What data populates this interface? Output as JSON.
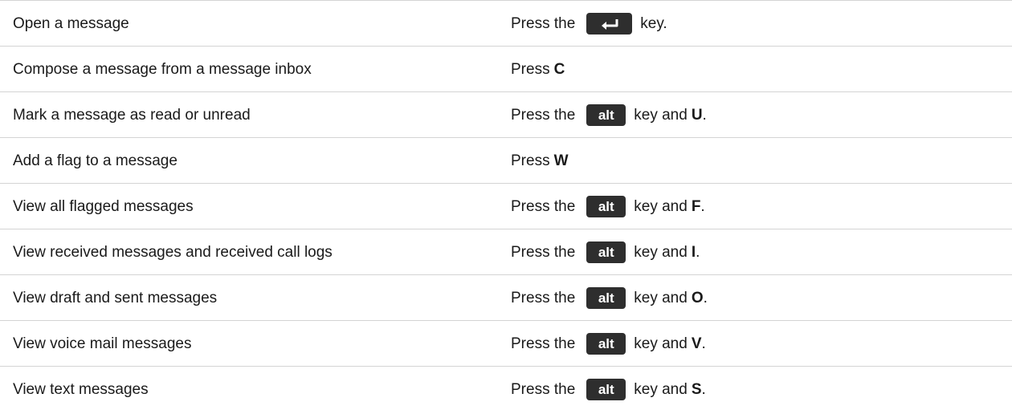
{
  "rows": [
    {
      "action": "Open a message",
      "press": "Press the",
      "key": "enter",
      "after": "key.",
      "letter": "",
      "end": ""
    },
    {
      "action": "Compose a message from a message inbox",
      "press": "Press",
      "key": "",
      "after": "",
      "letter": "C",
      "end": ""
    },
    {
      "action": "Mark a message as read or unread",
      "press": "Press the",
      "key": "alt",
      "after": "key and",
      "letter": "U",
      "end": "."
    },
    {
      "action": "Add a flag to a message",
      "press": "Press",
      "key": "",
      "after": "",
      "letter": "W",
      "end": ""
    },
    {
      "action": "View all flagged messages",
      "press": "Press the",
      "key": "alt",
      "after": "key and",
      "letter": "F",
      "end": "."
    },
    {
      "action": "View received messages and received call logs",
      "press": "Press the",
      "key": "alt",
      "after": "key and",
      "letter": "I",
      "end": "."
    },
    {
      "action": "View draft and sent messages",
      "press": "Press the",
      "key": "alt",
      "after": "key and",
      "letter": "O",
      "end": "."
    },
    {
      "action": "View voice mail messages",
      "press": "Press the",
      "key": "alt",
      "after": "key and",
      "letter": "V",
      "end": "."
    },
    {
      "action": "View text messages",
      "press": "Press the",
      "key": "alt",
      "after": "key and",
      "letter": "S",
      "end": "."
    }
  ],
  "keys": {
    "alt_label": "alt",
    "enter_icon": "enter-key-icon"
  },
  "colors": {
    "key_background": "#2e2e2e",
    "key_text": "#ffffff",
    "rule": "#d4d4d4"
  }
}
